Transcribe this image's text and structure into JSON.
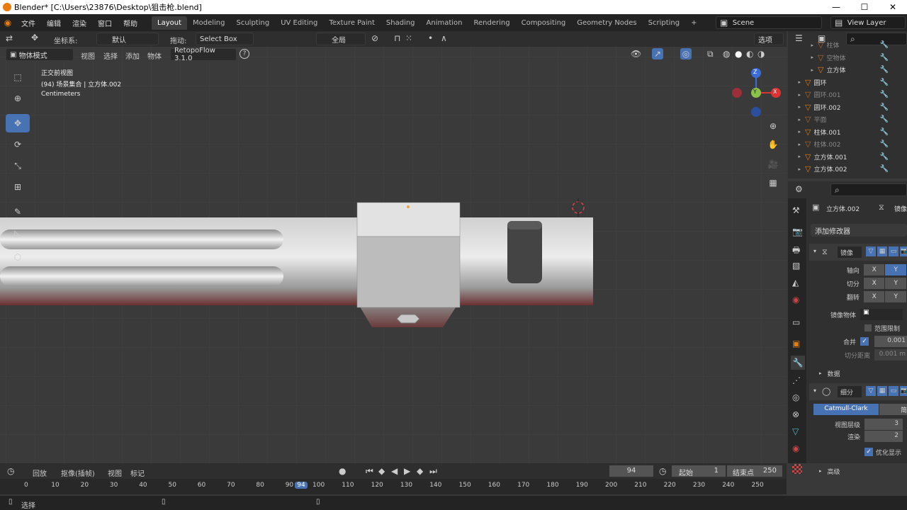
{
  "titlebar": {
    "title": "Blender* [C:\\Users\\23876\\Desktop\\狙击枪.blend]",
    "min": "—",
    "max": "☐",
    "close": "✕"
  },
  "topbar": {
    "menus": [
      "文件",
      "编辑",
      "渲染",
      "窗口",
      "帮助"
    ],
    "workspaces": [
      "Layout",
      "Modeling",
      "Sculpting",
      "UV Editing",
      "Texture Paint",
      "Shading",
      "Animation",
      "Rendering",
      "Compositing",
      "Geometry Nodes",
      "Scripting"
    ],
    "add": "+",
    "scene": "Scene",
    "viewlayer": "View Layer"
  },
  "header": {
    "coord_label": "坐标系:",
    "coord_value": "默认",
    "drag_label": "拖动:",
    "drag_value": "Select Box",
    "pivot": "全局",
    "options": "选项",
    "mode": "物体模式",
    "menus": [
      "视图",
      "选择",
      "添加",
      "物体"
    ],
    "addon": "RetopoFlow 3.1.0",
    "help": "?"
  },
  "viewport": {
    "view_name": "正交前视图",
    "collection": "(94) 场景集合 | 立方体.002",
    "units": "Centimeters"
  },
  "outliner": {
    "items": [
      {
        "name": "柱体",
        "dim": true,
        "indent": 2
      },
      {
        "name": "空物体",
        "dim": true,
        "indent": 2
      },
      {
        "name": "立方体",
        "dim": false,
        "indent": 2
      },
      {
        "name": "圆环",
        "dim": false,
        "indent": 1
      },
      {
        "name": "圆环.001",
        "dim": true,
        "indent": 1
      },
      {
        "name": "圆环.002",
        "dim": false,
        "indent": 1
      },
      {
        "name": "平面",
        "dim": true,
        "indent": 1
      },
      {
        "name": "柱体.001",
        "dim": false,
        "indent": 1
      },
      {
        "name": "柱体.002",
        "dim": true,
        "indent": 1
      },
      {
        "name": "立方体.001",
        "dim": false,
        "indent": 1
      },
      {
        "name": "立方体.002",
        "dim": false,
        "indent": 1
      }
    ]
  },
  "properties": {
    "object_name": "立方体.002",
    "mirror_tab": "镜像",
    "add_modifier": "添加修改器",
    "mirror": {
      "name": "镜像",
      "axis_label": "轴向",
      "bisect_label": "切分",
      "flip_label": "翻转",
      "x": "X",
      "y": "Y",
      "mirror_obj_label": "镜像物体",
      "clip_label": "范围限制",
      "merge_label": "合并",
      "merge_value": "0.001",
      "bisect_dist_label": "切分距离",
      "bisect_dist_value": "0.001 m",
      "data_label": "数据"
    },
    "subsurf": {
      "name": "细分",
      "method": "Catmull-Clark",
      "simple": "简",
      "levels_label": "视图层级",
      "levels_value": "3",
      "render_label": "渲染",
      "render_value": "2",
      "optimal_label": "优化显示",
      "advanced_label": "高级"
    }
  },
  "timeline": {
    "playback": "回放",
    "keying": "抠像(插帧)",
    "view": "视图",
    "marker": "标记",
    "current_frame": "94",
    "start_label": "起始",
    "start_value": "1",
    "end_label": "结束点",
    "end_value": "250",
    "ticks": [
      "0",
      "10",
      "20",
      "30",
      "40",
      "50",
      "60",
      "70",
      "80",
      "90",
      "94",
      "100",
      "110",
      "120",
      "130",
      "140",
      "150",
      "160",
      "170",
      "180",
      "190",
      "200",
      "210",
      "220",
      "230",
      "240",
      "250"
    ]
  },
  "statusbar": {
    "select": "选择"
  }
}
